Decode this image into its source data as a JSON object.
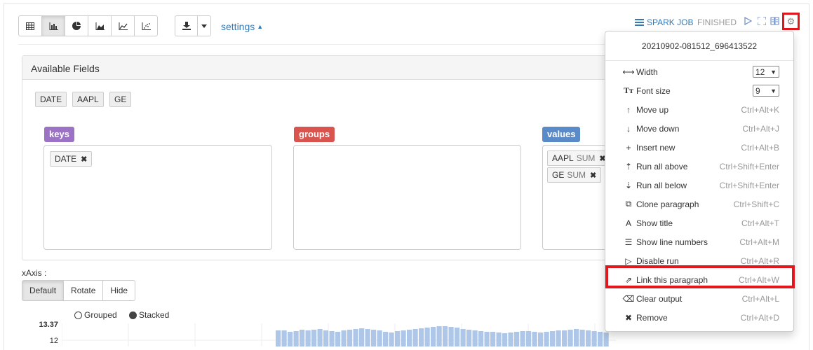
{
  "toolbar": {
    "view_buttons": [
      "table-icon",
      "bar-chart-icon",
      "pie-chart-icon",
      "area-chart-icon",
      "line-chart-icon",
      "scatter-chart-icon"
    ],
    "settings_label": "settings"
  },
  "header": {
    "spark_job_label": "SPARK JOB",
    "status": "FINISHED"
  },
  "fields_panel": {
    "title": "Available Fields",
    "fields": [
      "DATE",
      "AAPL",
      "GE"
    ],
    "keys_label": "keys",
    "groups_label": "groups",
    "values_label": "values",
    "keys_items": [
      {
        "name": "DATE"
      }
    ],
    "values_items": [
      {
        "name": "AAPL",
        "agg": "SUM"
      },
      {
        "name": "GE",
        "agg": "SUM"
      }
    ]
  },
  "xaxis": {
    "label": "xAxis :",
    "options": [
      "Default",
      "Rotate",
      "Hide"
    ],
    "selected": "Default"
  },
  "chart_mode": {
    "grouped_label": "Grouped",
    "stacked_label": "Stacked",
    "selected": "Stacked"
  },
  "chart_data": {
    "type": "bar",
    "y_ticks": [
      "13.37",
      "12"
    ]
  },
  "menu": {
    "paragraph_id": "20210902-081512_696413522",
    "width_label": "Width",
    "width_value": "12",
    "font_label": "Font size",
    "font_value": "9",
    "items": [
      {
        "label": "Move up",
        "shortcut": "Ctrl+Alt+K",
        "icon": "↑"
      },
      {
        "label": "Move down",
        "shortcut": "Ctrl+Alt+J",
        "icon": "↓"
      },
      {
        "label": "Insert new",
        "shortcut": "Ctrl+Alt+B",
        "icon": "+"
      },
      {
        "label": "Run all above",
        "shortcut": "Ctrl+Shift+Enter",
        "icon": "⇡"
      },
      {
        "label": "Run all below",
        "shortcut": "Ctrl+Shift+Enter",
        "icon": "⇣"
      },
      {
        "label": "Clone paragraph",
        "shortcut": "Ctrl+Shift+C",
        "icon": "⧉"
      },
      {
        "label": "Show title",
        "shortcut": "Ctrl+Alt+T",
        "icon": "A"
      },
      {
        "label": "Show line numbers",
        "shortcut": "Ctrl+Alt+M",
        "icon": "☰"
      },
      {
        "label": "Disable run",
        "shortcut": "Ctrl+Alt+R",
        "icon": "▷"
      },
      {
        "label": "Link this paragraph",
        "shortcut": "Ctrl+Alt+W",
        "icon": "⇗"
      },
      {
        "label": "Clear output",
        "shortcut": "Ctrl+Alt+L",
        "icon": "⌫"
      },
      {
        "label": "Remove",
        "shortcut": "Ctrl+Alt+D",
        "icon": "✖"
      }
    ]
  }
}
